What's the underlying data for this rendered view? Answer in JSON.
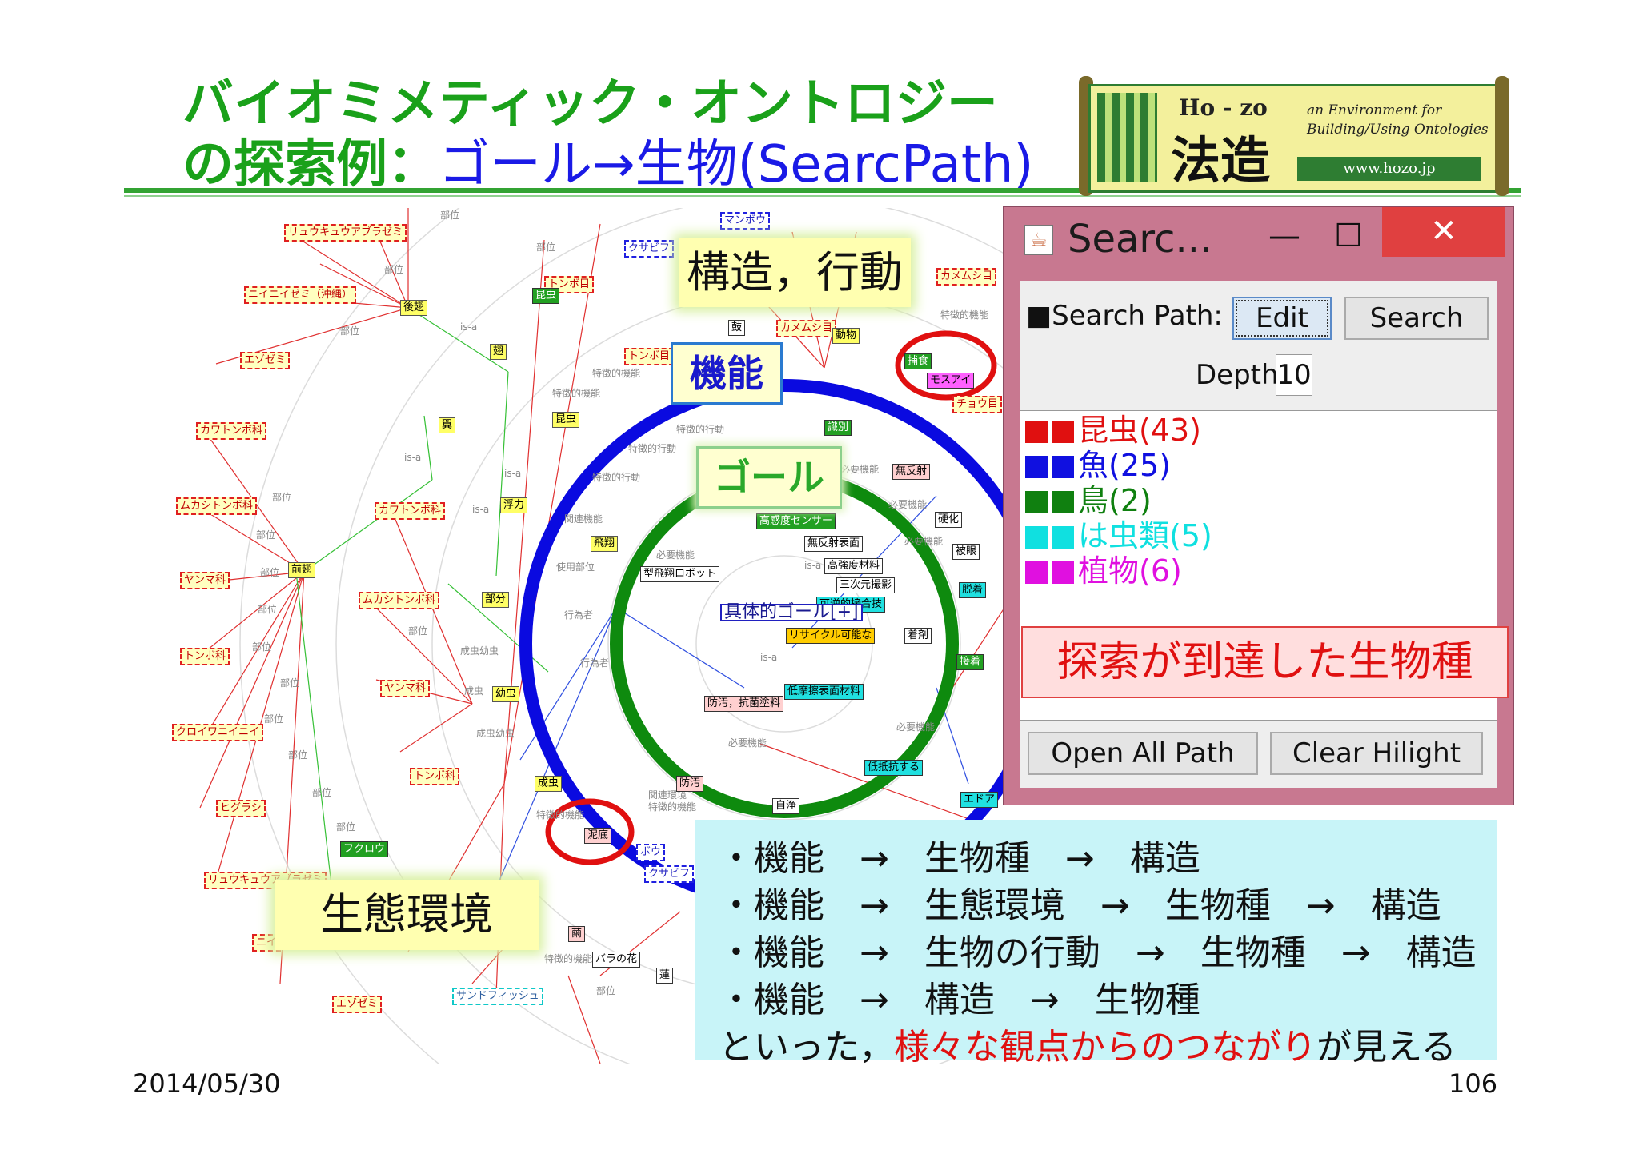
{
  "slide": {
    "title_line1": "バイオミメティック・オントロジー",
    "title_line2_prefix": "の探索例：",
    "title_line2_highlight": "ゴール→生物(SearcPath)",
    "date": "2014/05/30",
    "page_number": "106"
  },
  "logo": {
    "name": "Ho - zo",
    "kanji": "法造",
    "tagline": "an Environment for Building/Using Ontologies",
    "url": "www.hozo.jp"
  },
  "callouts": {
    "structure_behavior": "構造，行動",
    "function": "機能",
    "goal": "ゴール",
    "ecology": "生態環境"
  },
  "graph": {
    "center_node": "具体的ゴール[+]",
    "nodes": [
      {
        "text": "リュウキュウアブラゼミ",
        "style": "r"
      },
      {
        "text": "ニイニイゼミ（沖縄）",
        "style": "r"
      },
      {
        "text": "エゾゼミ",
        "style": "r"
      },
      {
        "text": "カワトンボ科",
        "style": "r"
      },
      {
        "text": "ムカシトンボ科",
        "style": "r"
      },
      {
        "text": "ヤンマ科",
        "style": "r"
      },
      {
        "text": "トンボ科",
        "style": "r"
      },
      {
        "text": "クロイワニイニイ",
        "style": "r"
      },
      {
        "text": "ヒグラシ",
        "style": "r"
      },
      {
        "text": "リュウキュウアブラゼミ",
        "style": "r"
      },
      {
        "text": "ニイ",
        "style": "r"
      },
      {
        "text": "エゾゼミ",
        "style": "r"
      },
      {
        "text": "カワトンボ科",
        "style": "r"
      },
      {
        "text": "ムカシトンボ科",
        "style": "r"
      },
      {
        "text": "ヤンマ科",
        "style": "r"
      },
      {
        "text": "トンボ科",
        "style": "r"
      },
      {
        "text": "トンボ目",
        "style": "r"
      },
      {
        "text": "トンボ目",
        "style": "r"
      },
      {
        "text": "クサビフ",
        "style": "b"
      },
      {
        "text": "マンボウ",
        "style": "b"
      },
      {
        "text": "ボウ",
        "style": "b"
      },
      {
        "text": "クサビフ",
        "style": "b"
      },
      {
        "text": "サンドフィッシュ",
        "style": "c"
      },
      {
        "text": "後翅",
        "style": "y"
      },
      {
        "text": "翅",
        "style": "y"
      },
      {
        "text": "翼",
        "style": "y"
      },
      {
        "text": "前翅",
        "style": "y"
      },
      {
        "text": "浮力",
        "style": "y"
      },
      {
        "text": "飛翔",
        "style": "y"
      },
      {
        "text": "部分",
        "style": "y"
      },
      {
        "text": "幼虫",
        "style": "y"
      },
      {
        "text": "成虫",
        "style": "y"
      },
      {
        "text": "昆虫",
        "style": "y"
      },
      {
        "text": "フクロウ",
        "style": "g"
      },
      {
        "text": "捕食",
        "style": "g"
      },
      {
        "text": "識別",
        "style": "g"
      },
      {
        "text": "高感度センサー",
        "style": "g"
      },
      {
        "text": "モスアイ",
        "style": "m"
      },
      {
        "text": "無反射",
        "style": "p"
      },
      {
        "text": "防汚",
        "style": "p"
      },
      {
        "text": "泥底",
        "style": "p"
      },
      {
        "text": "繭",
        "style": "p"
      },
      {
        "text": "バラの花",
        "style": "w"
      },
      {
        "text": "自浄",
        "style": "w"
      },
      {
        "text": "硬化",
        "style": "w"
      },
      {
        "text": "被眼",
        "style": "w"
      },
      {
        "text": "蓮",
        "style": "w"
      },
      {
        "text": "鼓",
        "style": "w"
      },
      {
        "text": "無反射表面",
        "style": "w"
      },
      {
        "text": "高強度材料",
        "style": "w"
      },
      {
        "text": "三次元撮影",
        "style": "w"
      },
      {
        "text": "型飛翔ロボット",
        "style": "w"
      },
      {
        "text": "可逆的接合技",
        "style": "cy"
      },
      {
        "text": "低摩擦表面材料",
        "style": "cy"
      },
      {
        "text": "低抵抗する",
        "style": "cy"
      },
      {
        "text": "脱着",
        "style": "cy"
      },
      {
        "text": "エドア",
        "style": "cy"
      },
      {
        "text": "リサイクル可能な",
        "style": "o"
      },
      {
        "text": "着剤",
        "style": "w"
      },
      {
        "text": "接着",
        "style": "g"
      },
      {
        "text": "防汚，抗菌塗料",
        "style": "p"
      },
      {
        "text": "カメムシ目",
        "style": "r"
      },
      {
        "text": "カメムシ目",
        "style": "r"
      },
      {
        "text": "チョウ目",
        "style": "r"
      },
      {
        "text": "昆虫",
        "style": "g"
      },
      {
        "text": "動物",
        "style": "y"
      }
    ],
    "edge_labels": [
      "部位",
      "is-a",
      "特徴的機能",
      "特徴的行動",
      "必要機能",
      "関連機能",
      "使用部位",
      "行為者",
      "成虫幼虫",
      "成虫",
      "関連環境"
    ]
  },
  "search_window": {
    "title": "Searc...",
    "minimize": "—",
    "maximize": "☐",
    "close": "✕",
    "search_path_label": "■Search Path:",
    "edit_button": "Edit",
    "search_button": "Search",
    "depth_label": "Depth",
    "depth_value": "10",
    "results": [
      {
        "label": "昆虫(43)",
        "color": "#e01010"
      },
      {
        "label": "魚(25)",
        "color": "#1010e0"
      },
      {
        "label": "鳥(2)",
        "color": "#108010"
      },
      {
        "label": "は虫類(5)",
        "color": "#10e0e0"
      },
      {
        "label": "植物(6)",
        "color": "#e010e0"
      }
    ],
    "reached_note": "探索が到達した生物種",
    "open_all_path_button": "Open All Path",
    "clear_highlight_button": "Clear Hilight"
  },
  "notes": {
    "line1": "・機能　→　生物種　→　構造",
    "line2": "・機能　→　生態環境　→　生物種　→　構造",
    "line3": "・機能　→　生物の行動　→　生物種　→　構造",
    "line4": "・機能　→　構造　→　生物種",
    "line5_prefix": "といった，",
    "line5_red": "様々な観点からのつながり",
    "line5_suffix": "が見える"
  },
  "colors": {
    "title_green": "#1aa11a",
    "title_blue": "#1a1ae6",
    "function_circle": "#0a0ae0",
    "goal_circle": "#0e8a0e",
    "highlight_circle": "#e01010",
    "window_frame": "#c87890",
    "close_button": "#e04040"
  }
}
